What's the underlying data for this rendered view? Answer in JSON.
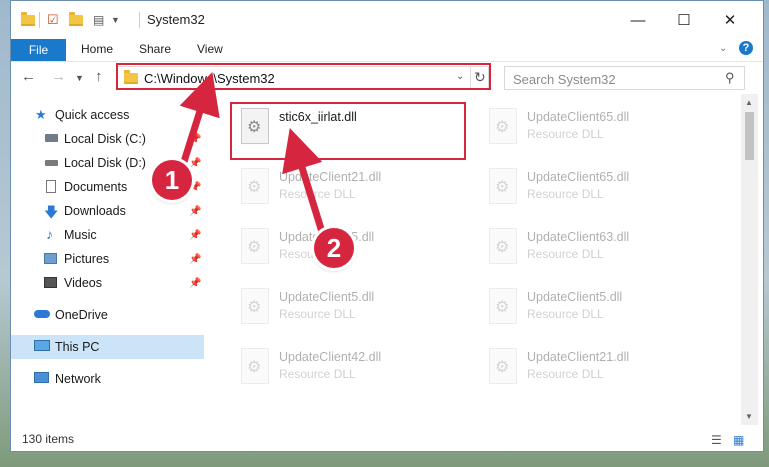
{
  "window": {
    "title": "System32"
  },
  "ribbon": {
    "tabs": [
      {
        "label": "File"
      },
      {
        "label": "Home"
      },
      {
        "label": "Share"
      },
      {
        "label": "View"
      }
    ]
  },
  "address": {
    "path": "C:\\Windows\\System32",
    "search_placeholder": "Search System32"
  },
  "sidebar": {
    "items": [
      {
        "label": "Quick access",
        "icon": "star-icon"
      },
      {
        "label": "Local Disk (C:)",
        "icon": "drive-icon",
        "pinned": true
      },
      {
        "label": "Local Disk (D:)",
        "icon": "drive-icon",
        "pinned": true
      },
      {
        "label": "Documents",
        "icon": "documents-icon",
        "pinned": true
      },
      {
        "label": "Downloads",
        "icon": "download-icon",
        "pinned": true
      },
      {
        "label": "Music",
        "icon": "music-icon",
        "pinned": true
      },
      {
        "label": "Pictures",
        "icon": "pictures-icon",
        "pinned": true
      },
      {
        "label": "Videos",
        "icon": "videos-icon",
        "pinned": true
      },
      {
        "label": "OneDrive",
        "icon": "cloud-icon"
      },
      {
        "label": "This PC",
        "icon": "computer-icon",
        "selected": true
      },
      {
        "label": "Network",
        "icon": "network-icon"
      }
    ]
  },
  "files": [
    {
      "name": "stic6x_iirlat.dll",
      "type": ""
    },
    {
      "name": "UpdateClient65.dll",
      "type": "Resource DLL"
    },
    {
      "name": "UpdateClient21.dll",
      "type": "Resource DLL"
    },
    {
      "name": "UpdateClient65.dll",
      "type": "Resource DLL"
    },
    {
      "name": "UpdateClient5.dll",
      "type": "Resource DLL"
    },
    {
      "name": "UpdateClient63.dll",
      "type": "Resource DLL"
    },
    {
      "name": "UpdateClient5.dll",
      "type": "Resource DLL"
    },
    {
      "name": "UpdateClient5.dll",
      "type": "Resource DLL"
    },
    {
      "name": "UpdateClient42.dll",
      "type": "Resource DLL"
    },
    {
      "name": "UpdateClient21.dll",
      "type": "Resource DLL"
    }
  ],
  "status": {
    "item_count": "130 items"
  },
  "annotations": {
    "step1": "1",
    "step2": "2",
    "color": "#d6253f"
  }
}
